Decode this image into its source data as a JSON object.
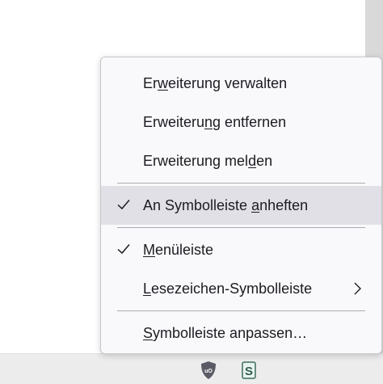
{
  "menu": {
    "items": [
      {
        "pre": "Er",
        "acc": "w",
        "post": "eiterung verwalten",
        "checked": false,
        "submenu": false
      },
      {
        "pre": "Erweiteru",
        "acc": "n",
        "post": "g entfernen",
        "checked": false,
        "submenu": false
      },
      {
        "pre": "Erweiterung mel",
        "acc": "d",
        "post": "en",
        "checked": false,
        "submenu": false
      },
      {
        "pre": "An Symbolleiste ",
        "acc": "a",
        "post": "nheften",
        "checked": true,
        "submenu": false
      },
      {
        "pre": "",
        "acc": "M",
        "post": "enüleiste",
        "checked": true,
        "submenu": false
      },
      {
        "pre": "",
        "acc": "L",
        "post": "esezeichen-Symbolleiste",
        "checked": false,
        "submenu": true
      },
      {
        "pre": "",
        "acc": "S",
        "post": "ymbolleiste anpassen…",
        "checked": false,
        "submenu": false
      }
    ]
  },
  "toolbar": {
    "icons": [
      "ublock-origin-icon",
      "stylus-extension-icon"
    ],
    "ublock_text": "uO",
    "stylus_text": "S"
  },
  "colors": {
    "menu_bg": "#f9f9fb",
    "highlight": "#e0e0e6",
    "text": "#1c1b22",
    "separator": "#8f8f9d",
    "bottom_bar": "#ececec"
  }
}
